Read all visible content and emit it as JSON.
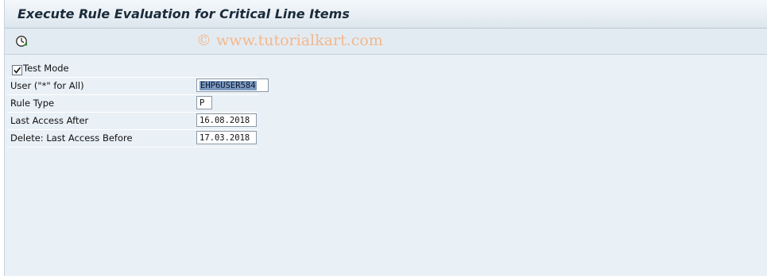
{
  "window": {
    "title": "Execute Rule Evaluation for Critical Line Items"
  },
  "toolbar": {
    "execute_icon": "execute-clock-icon",
    "watermark": "© www.tutorialkart.com"
  },
  "form": {
    "test_mode": {
      "label": "Test Mode",
      "checked": true
    },
    "user": {
      "label": "User (\"*\" for All)",
      "value": "EHP6USER584"
    },
    "rule_type": {
      "label": "Rule Type",
      "value": "P"
    },
    "last_access_after": {
      "label": "Last Access After",
      "value": "16.08.2018"
    },
    "delete_last_access_before": {
      "label": "Delete: Last Access Before",
      "value": "17.03.2018"
    }
  }
}
